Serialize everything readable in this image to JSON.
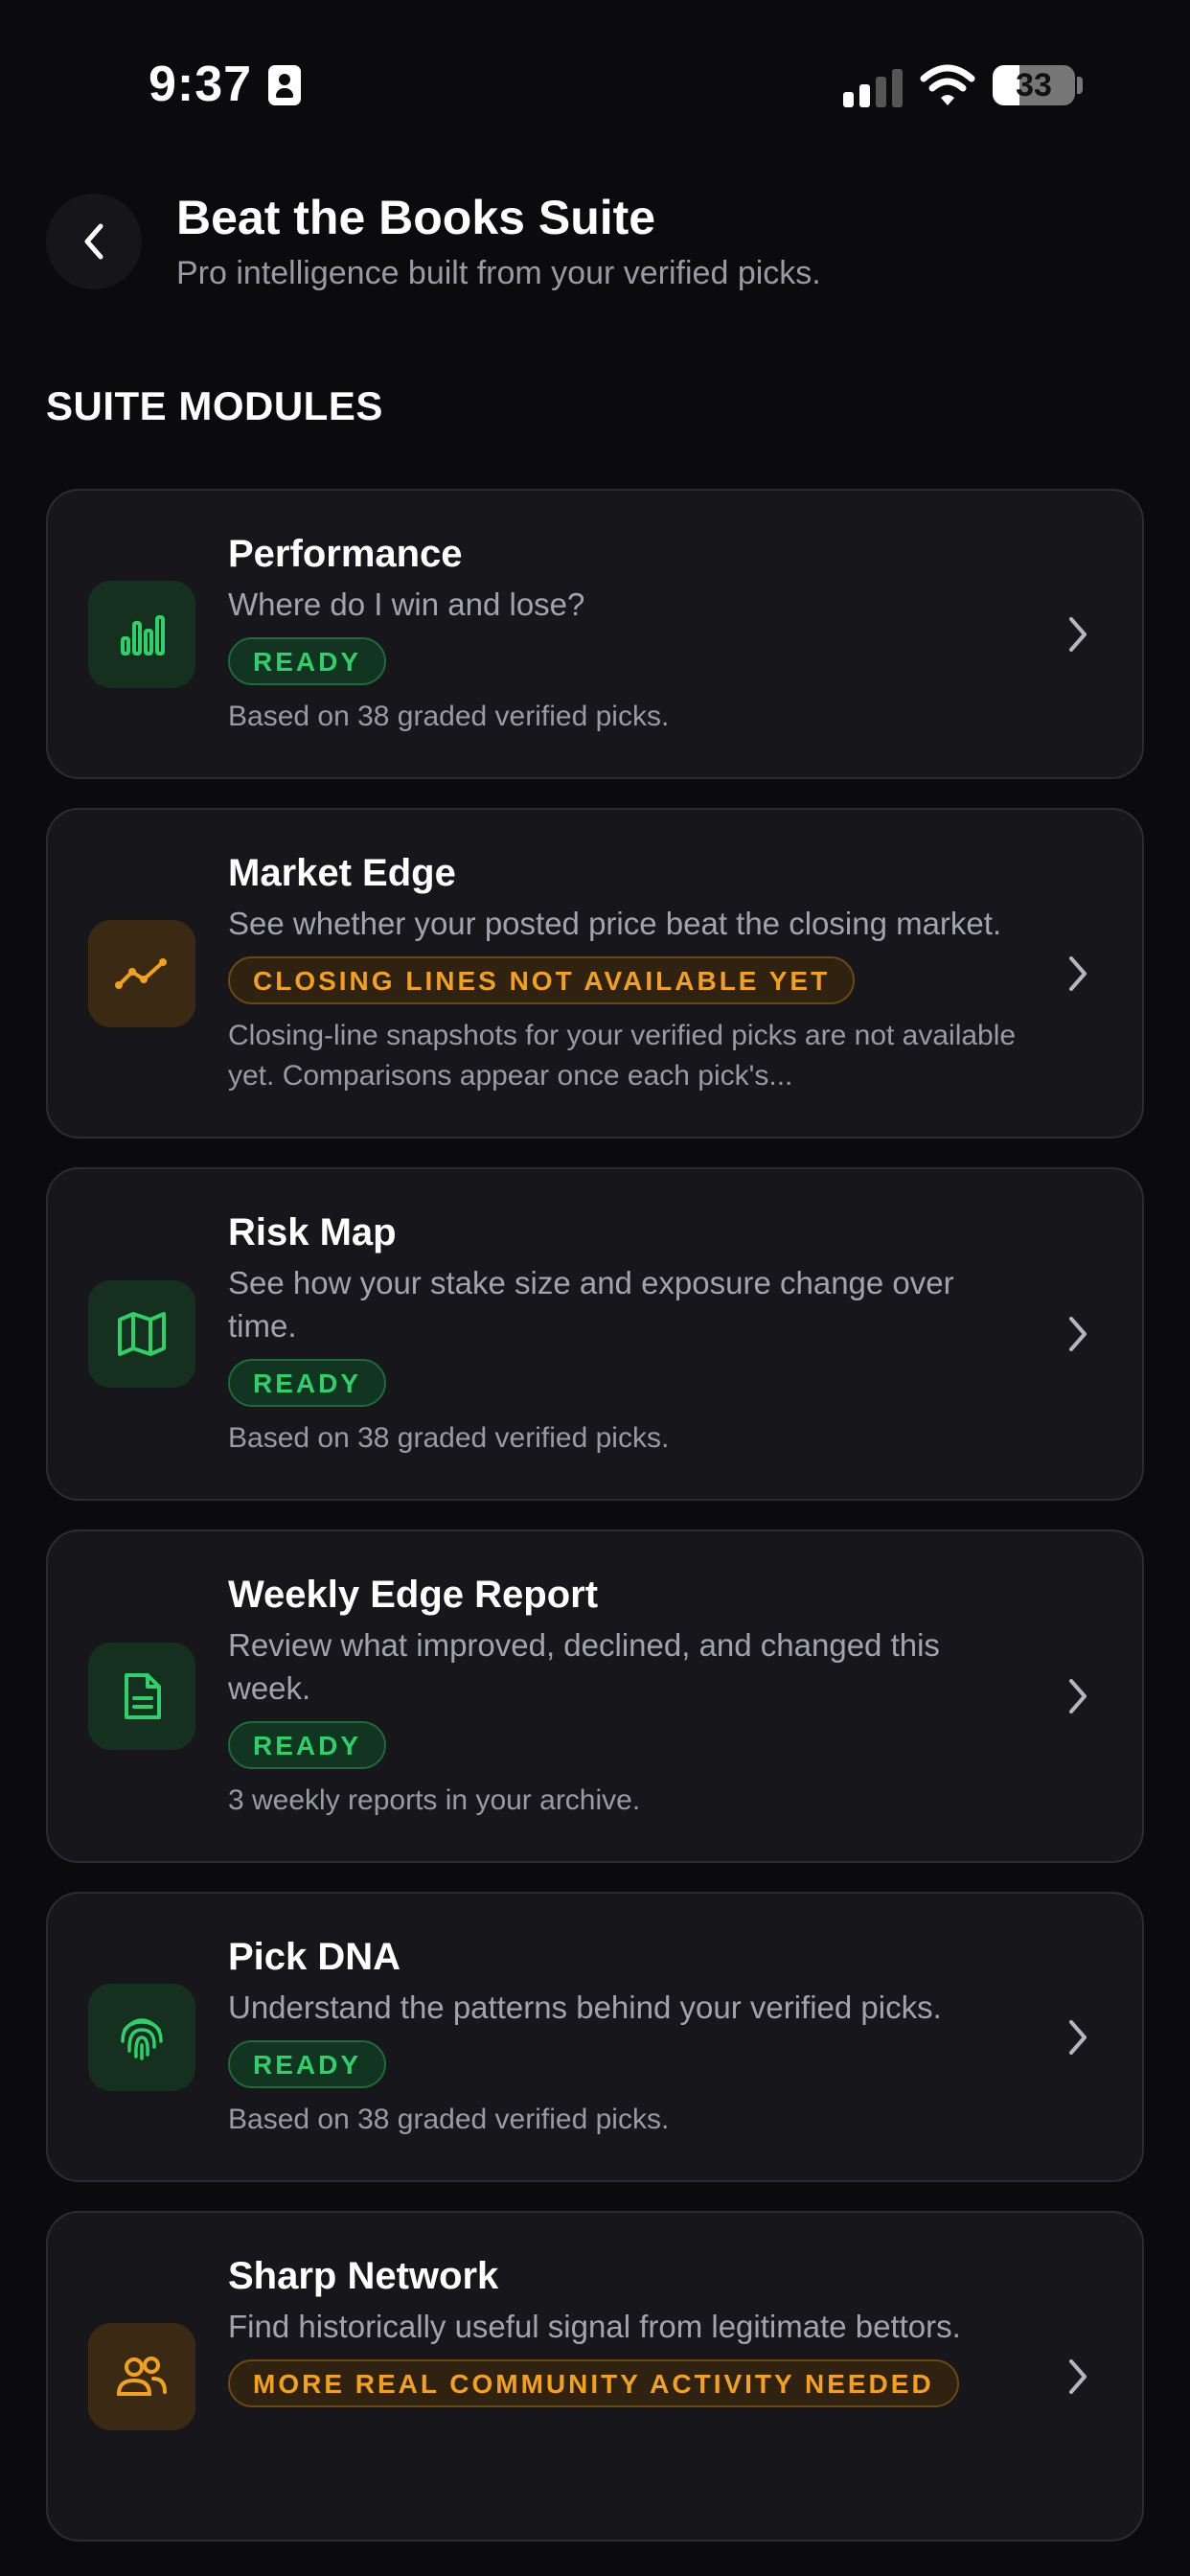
{
  "status_bar": {
    "time": "9:37",
    "battery": "33"
  },
  "header": {
    "title": "Beat the Books Suite",
    "subtitle": "Pro intelligence built from your verified picks."
  },
  "section_title": "SUITE MODULES",
  "modules": [
    {
      "name": "Performance",
      "description": "Where do I win and lose?",
      "badge": "READY",
      "footer": "Based on 38 graded verified picks."
    },
    {
      "name": "Market Edge",
      "description": "See whether your posted price beat the closing market.",
      "badge": "CLOSING LINES NOT AVAILABLE YET",
      "footer": "Closing-line snapshots for your verified picks are not available yet. Comparisons appear once each pick's..."
    },
    {
      "name": "Risk Map",
      "description": "See how your stake size and exposure change over time.",
      "badge": "READY",
      "footer": "Based on 38 graded verified picks."
    },
    {
      "name": "Weekly Edge Report",
      "description": "Review what improved, declined, and changed this week.",
      "badge": "READY",
      "footer": "3 weekly reports in your archive."
    },
    {
      "name": "Pick DNA",
      "description": "Understand the patterns behind your verified picks.",
      "badge": "READY",
      "footer": "Based on 38 graded verified picks."
    },
    {
      "name": "Sharp Network",
      "description": "Find historically useful signal from legitimate bettors.",
      "badge": "MORE REAL COMMUNITY ACTIVITY NEEDED",
      "footer": ""
    }
  ],
  "colors": {
    "ready_green": "#2fd06a",
    "warning_amber": "#f2a11c",
    "background": "#0b0b0d",
    "card": "#17171b"
  },
  "icons": [
    "bar-chart-icon",
    "trend-line-icon",
    "map-icon",
    "document-icon",
    "fingerprint-icon",
    "people-icon"
  ]
}
